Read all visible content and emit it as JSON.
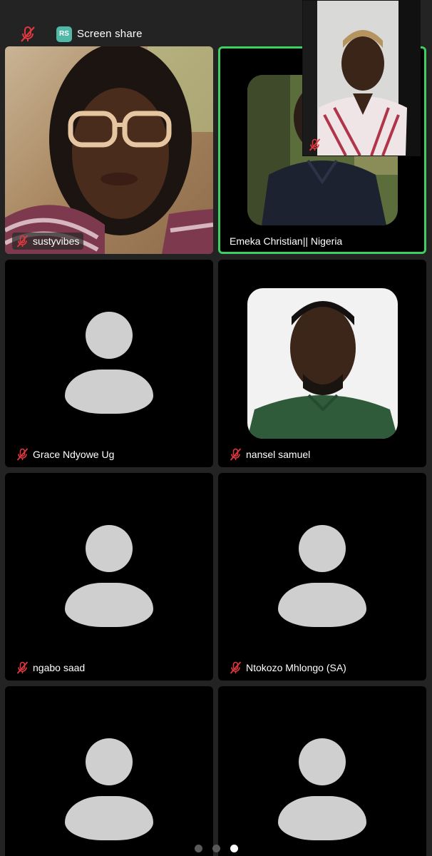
{
  "topbar": {
    "share_badge": "RS",
    "share_label": "Screen share",
    "mic_icon": "muted-mic-icon"
  },
  "tiles": [
    {
      "name": "sustyvibes",
      "muted": true,
      "kind": "video"
    },
    {
      "name": "Emeka Christian|| Nigeria",
      "muted": false,
      "kind": "photo",
      "active": true
    },
    {
      "name": "Grace Ndyowe Ug",
      "muted": true,
      "kind": "avatar"
    },
    {
      "name": "nansel samuel",
      "muted": true,
      "kind": "photo"
    },
    {
      "name": "ngabo saad",
      "muted": true,
      "kind": "avatar"
    },
    {
      "name": "Ntokozo Mhlongo (SA)",
      "muted": true,
      "kind": "avatar"
    },
    {
      "name": "",
      "muted": false,
      "kind": "avatar"
    },
    {
      "name": "",
      "muted": false,
      "kind": "avatar"
    }
  ],
  "self_view": {
    "muted": true
  },
  "pager": {
    "pages": 3,
    "current_page": 3
  },
  "colors": {
    "background": "#232323",
    "tile": "#000000",
    "active_border": "#3fcf61",
    "muted_red": "#e0383e",
    "avatar_gray": "#cfcfcf",
    "share_badge": "#4fb8a6"
  }
}
